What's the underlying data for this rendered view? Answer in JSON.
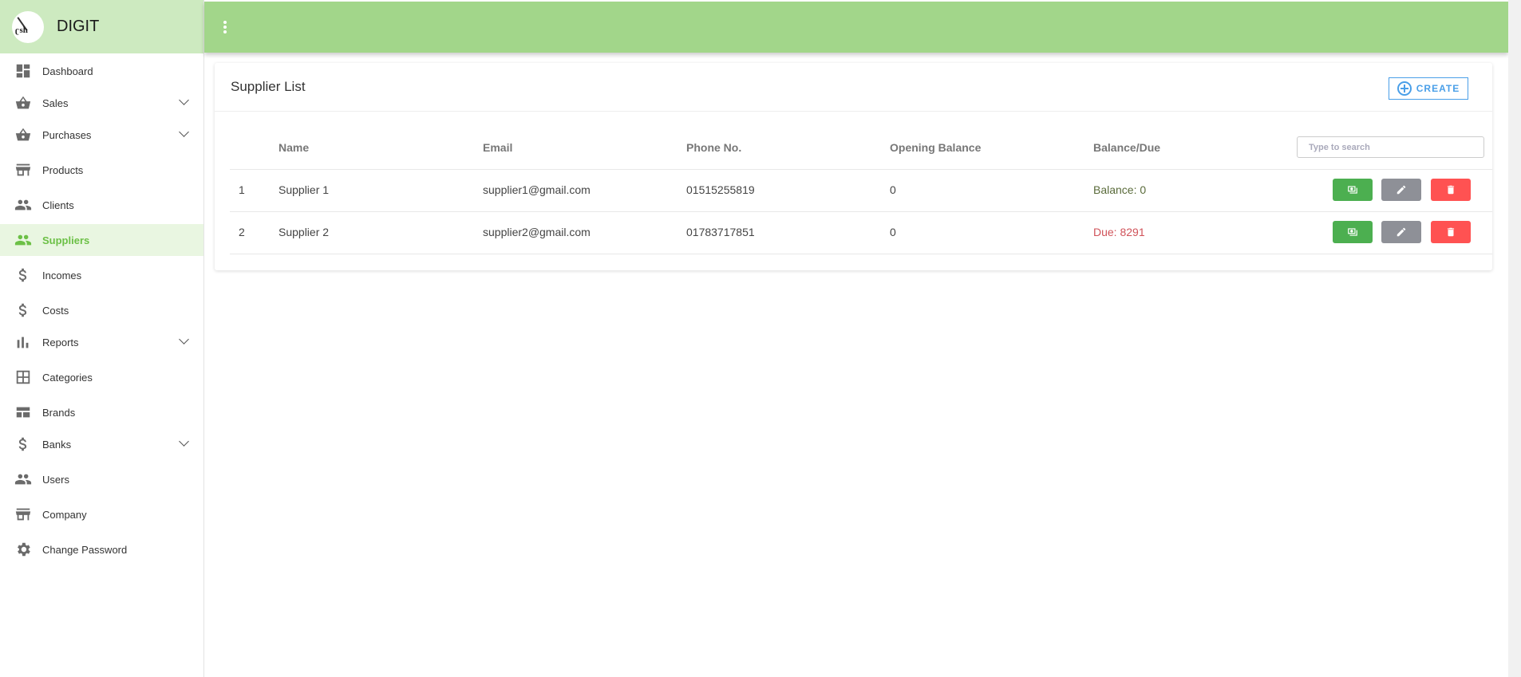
{
  "app": {
    "name": "DIGIT",
    "logo_text": "sh"
  },
  "sidebar": {
    "items": [
      {
        "label": "Dashboard",
        "icon": "dashboard-icon"
      },
      {
        "label": "Sales",
        "icon": "basket-icon",
        "expandable": true
      },
      {
        "label": "Purchases",
        "icon": "basket-icon",
        "expandable": true
      },
      {
        "label": "Products",
        "icon": "store-icon"
      },
      {
        "label": "Clients",
        "icon": "people-icon"
      },
      {
        "label": "Suppliers",
        "icon": "people-icon",
        "active": true
      },
      {
        "label": "Incomes",
        "icon": "dollar-icon"
      },
      {
        "label": "Costs",
        "icon": "dollar-icon"
      },
      {
        "label": "Reports",
        "icon": "bar-chart-icon",
        "expandable": true
      },
      {
        "label": "Categories",
        "icon": "grid-icon"
      },
      {
        "label": "Brands",
        "icon": "table-icon"
      },
      {
        "label": "Banks",
        "icon": "dollar-icon",
        "expandable": true
      },
      {
        "label": "Users",
        "icon": "people-icon"
      },
      {
        "label": "Company",
        "icon": "store-icon"
      },
      {
        "label": "Change Password",
        "icon": "gear-icon"
      }
    ]
  },
  "card": {
    "title": "Supplier List",
    "create_label": "CREATE"
  },
  "table": {
    "headers": [
      "Name",
      "Email",
      "Phone No.",
      "Opening Balance",
      "Balance/Due"
    ],
    "search_placeholder": "Type to search",
    "rows": [
      {
        "no": "1",
        "name": "Supplier 1",
        "email": "supplier1@gmail.com",
        "phone": "01515255819",
        "opening": "0",
        "balance": "Balance: 0",
        "balance_color": "#5a6b3a"
      },
      {
        "no": "2",
        "name": "Supplier 2",
        "email": "supplier2@gmail.com",
        "phone": "01783717851",
        "opening": "0",
        "balance": "Due: 8291",
        "balance_color": "#d0535a"
      }
    ]
  },
  "colors": {
    "topbar": "#a2d68a",
    "brand_bg": "#cdeac0",
    "active": "#6cc046",
    "accent": "#4a9fe8"
  }
}
